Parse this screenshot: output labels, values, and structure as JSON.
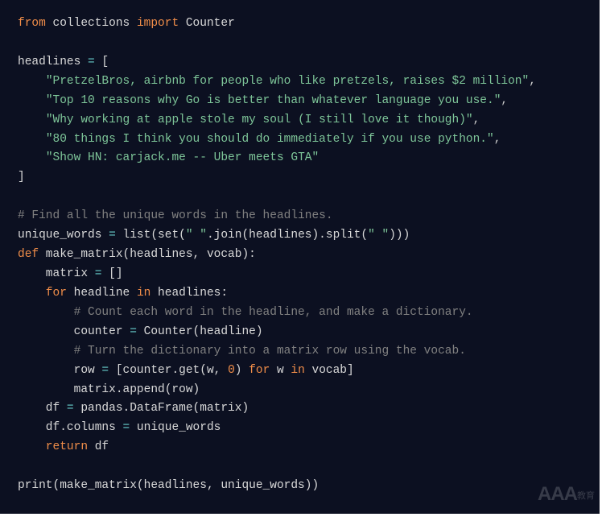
{
  "code": {
    "l1_from": "from",
    "l1_mod": " collections ",
    "l1_import": "import",
    "l1_name": " Counter",
    "l2": "",
    "l3_var": "headlines ",
    "l3_eq": "=",
    "l3_br": " [",
    "h1": "\"PretzelBros, airbnb for people who like pretzels, raises $2 million\"",
    "h2": "\"Top 10 reasons why Go is better than whatever language you use.\"",
    "h3": "\"Why working at apple stole my soul (I still love it though)\"",
    "h4": "\"80 things I think you should do immediately if you use python.\"",
    "h5": "\"Show HN: carjack.me -- Uber meets GTA\"",
    "l9_br": "]",
    "cmt1": "# Find all the unique words in the headlines.",
    "l11_a": "unique_words ",
    "l11_eq": "=",
    "l11_b": " list(set(",
    "l11_s1": "\" \"",
    "l11_c": ".join(headlines).split(",
    "l11_s2": "\" \"",
    "l11_d": ")))",
    "l12_def": "def",
    "l12_fn": " make_matrix",
    "l12_args": "(headlines, vocab):",
    "l13_a": "    matrix ",
    "l13_eq": "=",
    "l13_b": " []",
    "l14_for": "    for",
    "l14_a": " headline ",
    "l14_in": "in",
    "l14_b": " headlines:",
    "cmt2": "        # Count each word in the headline, and make a dictionary.",
    "l16_a": "        counter ",
    "l16_eq": "=",
    "l16_b": " Counter(headline)",
    "cmt3": "        # Turn the dictionary into a matrix row using the vocab.",
    "l18_a": "        row ",
    "l18_eq": "=",
    "l18_b": " [counter.get(w, ",
    "l18_num": "0",
    "l18_c": ") ",
    "l18_for": "for",
    "l18_d": " w ",
    "l18_in": "in",
    "l18_e": " vocab]",
    "l19": "        matrix.append(row)",
    "l20_a": "    df ",
    "l20_eq": "=",
    "l20_b": " pandas.DataFrame(matrix)",
    "l21_a": "    df.columns ",
    "l21_eq": "=",
    "l21_b": " unique_words",
    "l22_ret": "    return",
    "l22_a": " df",
    "l24": "print(make_matrix(headlines, unique_words))"
  },
  "watermark": {
    "main": "AAA",
    "sub": "教育"
  }
}
